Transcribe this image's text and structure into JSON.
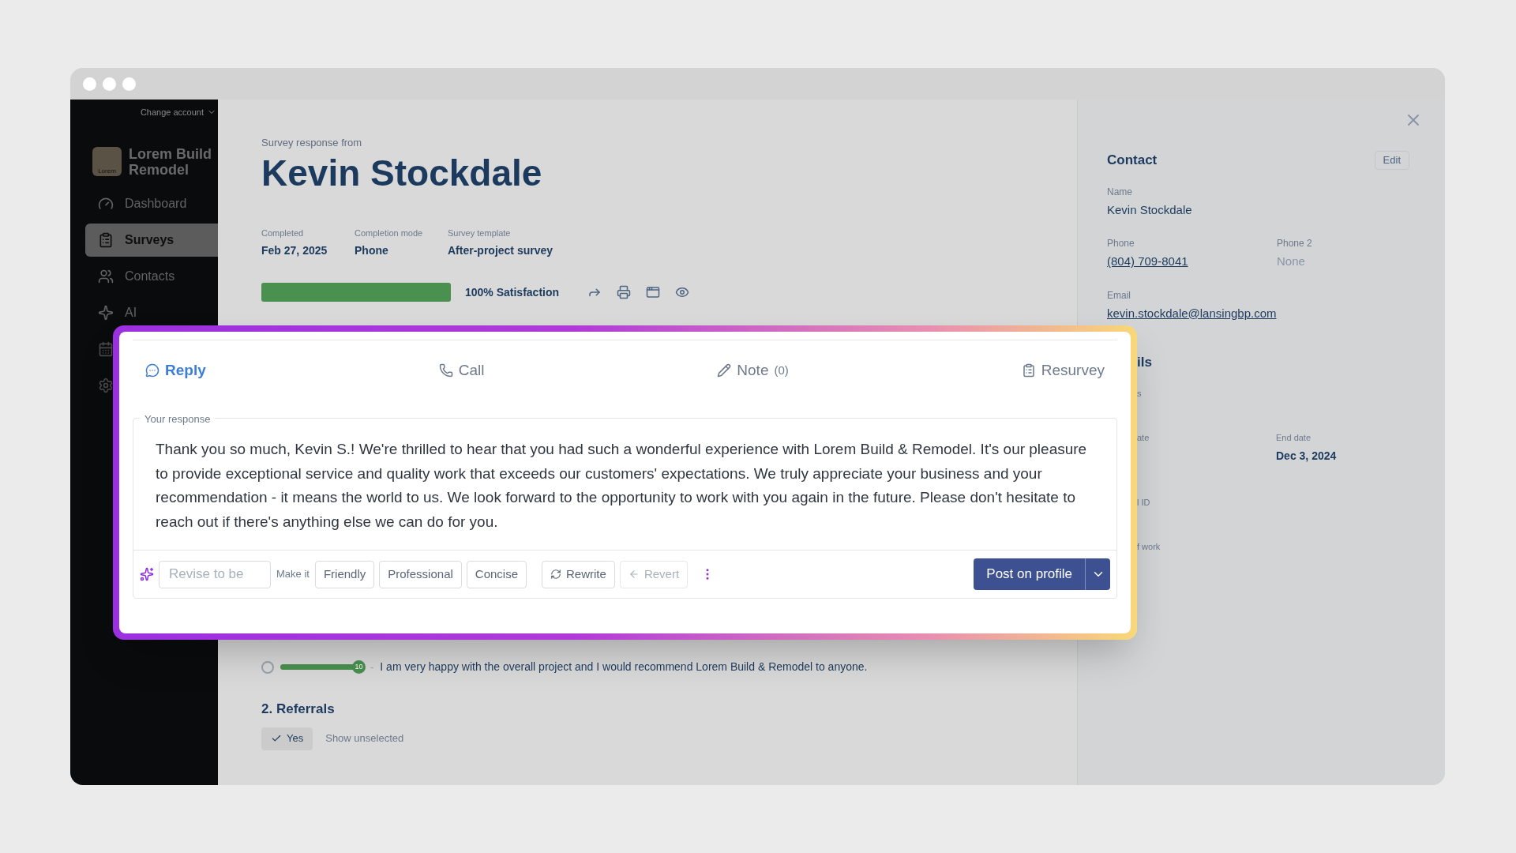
{
  "sidebar": {
    "account_switch": "Change account",
    "logo_text": "Lorem",
    "company_lines": [
      "Lorem Build",
      "Remodel"
    ],
    "items": [
      {
        "label": "Dashboard",
        "selected": false
      },
      {
        "label": "Surveys",
        "selected": true
      },
      {
        "label": "Contacts",
        "selected": false
      },
      {
        "label": "AI",
        "selected": false
      }
    ]
  },
  "header": {
    "eyebrow": "Survey response from",
    "name": "Kevin Stockdale",
    "meta": [
      {
        "label": "Completed",
        "value": "Feb 27, 2025"
      },
      {
        "label": "Completion mode",
        "value": "Phone"
      },
      {
        "label": "Survey template",
        "value": "After-project survey"
      }
    ],
    "satisfaction": {
      "level": 1,
      "reading": "100% Satisfaction"
    }
  },
  "questions": {
    "score": {
      "level": 1,
      "value": "10",
      "separator": "-",
      "comment": "I am very happy with the overall project and I would recommend Lorem Build & Remodel to anyone."
    },
    "referrals": {
      "title": "2. Referrals",
      "answer": {
        "label": "Yes",
        "checked": true
      },
      "toggle": "Show unselected"
    }
  },
  "contact_panel": {
    "title": "Contact",
    "edit": "Edit",
    "fields": [
      {
        "label": "Name",
        "value": "Kevin Stockdale",
        "kind": "text"
      },
      {
        "label": "Phone",
        "value": "(804) 709-8041",
        "kind": "link"
      },
      {
        "label": "Phone 2",
        "value": "None",
        "kind": "empty"
      },
      {
        "label": "Email",
        "value": "kevin.stockdale@lansingbp.com",
        "kind": "link"
      }
    ],
    "details_heading": "ils",
    "details": [
      {
        "label": "s"
      },
      {
        "label": "ate",
        "side_label": "End date",
        "side_value": "Dec 3, 2024"
      },
      {
        "label": "l ID"
      },
      {
        "label": "f work"
      }
    ]
  },
  "reply_dialog": {
    "tabs": [
      {
        "label": "Reply",
        "selected": true
      },
      {
        "label": "Call",
        "selected": false
      },
      {
        "label": "Note",
        "count": "(0)",
        "selected": false
      },
      {
        "label": "Resurvey",
        "selected": false
      }
    ],
    "response_legend": "Your response",
    "response_text": "Thank you so much, Kevin S.! We're thrilled to hear that you had such a wonderful experience with Lorem Build & Remodel. It's our pleasure to provide exceptional service and quality work that exceeds our customers' expectations. We truly appreciate your business and your recommendation - it means the world to us. We look forward to the opportunity to work with you again in the future. Please don't hesitate to reach out if there's anything else we can do for you.",
    "revise_placeholder": "Revise to be",
    "make_it": "Make it",
    "tones": [
      "Friendly",
      "Professional",
      "Concise"
    ],
    "rewrite": "Rewrite",
    "revert": {
      "label": "Revert",
      "disabled": true
    },
    "post": "Post on profile"
  }
}
